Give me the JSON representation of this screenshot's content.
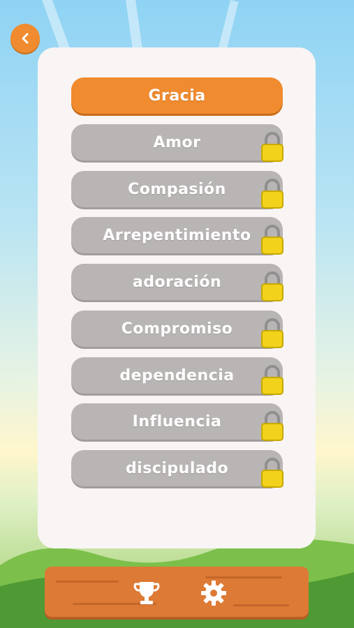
{
  "levels": [
    {
      "label": "Gracia",
      "locked": false
    },
    {
      "label": "Amor",
      "locked": true
    },
    {
      "label": "Compasión",
      "locked": true
    },
    {
      "label": "Arrepentimiento",
      "locked": true
    },
    {
      "label": "adoración",
      "locked": true
    },
    {
      "label": "Compromiso",
      "locked": true
    },
    {
      "label": "dependencia",
      "locked": true
    },
    {
      "label": "Influencia",
      "locked": true
    },
    {
      "label": "discipulado",
      "locked": true
    }
  ],
  "footer": {
    "icons": [
      "trophy-icon",
      "gear-icon"
    ]
  },
  "colors": {
    "accent": "#f08b2f",
    "locked": "#b9b5b4",
    "panel": "#f8f5f4",
    "lock": "#f2d21b"
  }
}
